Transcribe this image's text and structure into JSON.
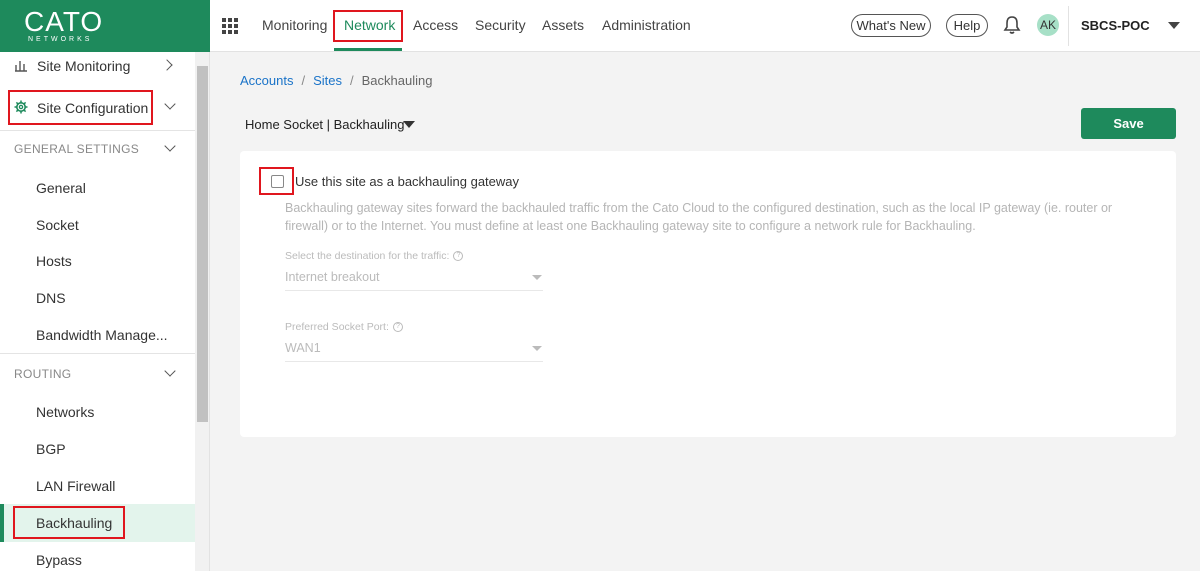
{
  "logo": {
    "name": "CATO",
    "tagline": "NETWORKS"
  },
  "topnav": {
    "items": [
      "Monitoring",
      "Network",
      "Access",
      "Security",
      "Assets",
      "Administration"
    ],
    "active": "Network",
    "whats_new": "What's New",
    "help": "Help",
    "avatar_initials": "AK",
    "account": "SBCS-POC"
  },
  "sidebar": {
    "site_monitoring": "Site Monitoring",
    "site_configuration": "Site Configuration",
    "general_settings": {
      "title": "GENERAL SETTINGS",
      "items": [
        "General",
        "Socket",
        "Hosts",
        "DNS",
        "Bandwidth Manage..."
      ]
    },
    "routing": {
      "title": "ROUTING",
      "items": [
        "Networks",
        "BGP",
        "LAN Firewall",
        "Backhauling",
        "Bypass"
      ]
    },
    "active_item": "Backhauling"
  },
  "breadcrumb": [
    "Accounts",
    "Sites",
    "Backhauling"
  ],
  "site_selector": "Home Socket | Backhauling",
  "save_label": "Save",
  "backhauling": {
    "checkbox_label": "Use this site as a backhauling gateway",
    "checkbox_checked": false,
    "description": "Backhauling gateway sites forward the backhauled traffic from the Cato Cloud to the configured destination, such as the local IP gateway (ie. router or firewall) or to the Internet. You must define at least one Backhauling gateway site to configure a network rule for Backhauling.",
    "destination_label": "Select the destination for the traffic:",
    "destination_value": "Internet breakout",
    "port_label": "Preferred Socket Port:",
    "port_value": "WAN1"
  },
  "colors": {
    "brand": "#1e8a5c",
    "highlight": "#e0161e",
    "link": "#1a73c8"
  }
}
